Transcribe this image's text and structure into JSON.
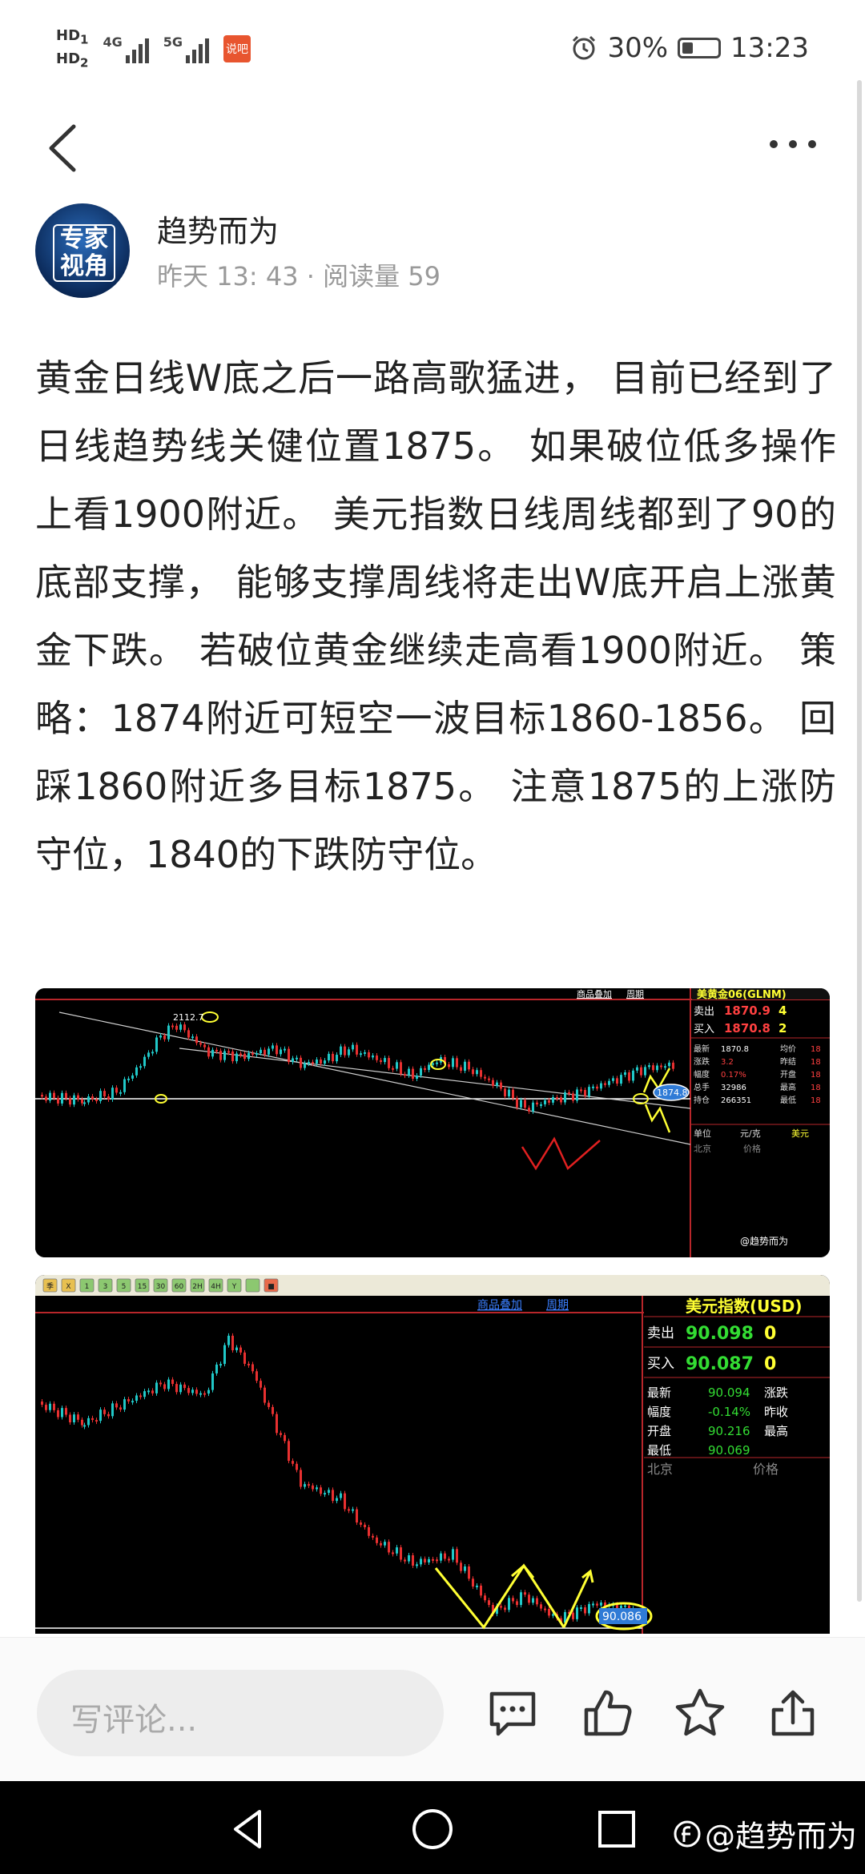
{
  "status_bar": {
    "hd1": "HD",
    "hd1_sub": "1",
    "hd2": "HD",
    "hd2_sub": "2",
    "net1": "4G",
    "net2": "5G",
    "app_tag": "说吧",
    "battery": "30%",
    "time": "13:23"
  },
  "author": {
    "avatar_text": "专家视角",
    "name": "趋势而为",
    "meta": "昨天 13: 43 · 阅读量 59"
  },
  "article": {
    "body": "黄金日线W底之后一路高歌猛进， 目前已经到了日线趋势线关健位置1875。 如果破位低多操作上看1900附近。 美元指数日线周线都到了90的底部支撑， 能够支撑周线将走出W底开启上涨黄金下跌。 若破位黄金继续走高看1900附近。 策略：1874附近可短空一波目标1860-1856。 回踩1860附近多目标1875。 注意1875的上涨防守位，1840的下跌防守位。"
  },
  "chart1": {
    "title": "美黄金06(GLNM)",
    "menu": [
      "商品叠加",
      "周期"
    ],
    "peak_label": "2112.7",
    "price_tag": "1874.8",
    "sell_label": "卖出",
    "sell_price": "1870.9",
    "sell_qty": "4",
    "buy_label": "买入",
    "buy_price": "1870.8",
    "buy_qty": "2",
    "stats": [
      {
        "k": "最新",
        "v": "1870.8",
        "k2": "均价",
        "v2": "18"
      },
      {
        "k": "涨跌",
        "v": "3.2",
        "k2": "昨结",
        "v2": "18"
      },
      {
        "k": "幅度",
        "v": "0.17%",
        "k2": "开盘",
        "v2": "18"
      },
      {
        "k": "总手",
        "v": "32986",
        "k2": "最高",
        "v2": "18"
      },
      {
        "k": "持仓",
        "v": "266351",
        "k2": "最低",
        "v2": "18"
      }
    ],
    "unit_label": "单位",
    "unit_value": "元/克",
    "check_label": "美元",
    "city_label": "北京",
    "price_col": "价格",
    "watermark": "@趋势而为"
  },
  "chart2": {
    "title": "美元指数(USD)",
    "menu": [
      "商品叠加",
      "周期"
    ],
    "toolbar": [
      "季",
      "X",
      "1",
      "3",
      "5",
      "15",
      "30",
      "60",
      "2H",
      "4H",
      "Y",
      "",
      "■"
    ],
    "sell_label": "卖出",
    "sell_price": "90.098",
    "sell_qty": "0",
    "buy_label": "买入",
    "buy_price": "90.087",
    "buy_qty": "0",
    "stats": [
      {
        "k": "最新",
        "v": "90.094",
        "k2": "涨跌"
      },
      {
        "k": "幅度",
        "v": "-0.14%",
        "k2": "昨收"
      },
      {
        "k": "开盘",
        "v": "90.216",
        "k2": "最高"
      },
      {
        "k": "最低",
        "v": "90.069",
        "k2": ""
      }
    ],
    "city_label": "北京",
    "price_col": "价格",
    "price_tag": "90.086"
  },
  "comment_bar": {
    "placeholder": "写评论..."
  },
  "nav_bar": {
    "watermark": "@趋势而为"
  }
}
